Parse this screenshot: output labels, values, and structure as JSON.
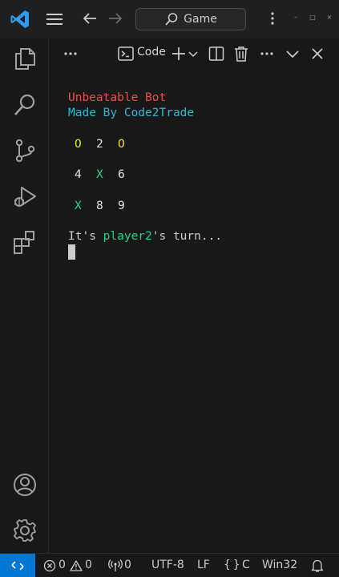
{
  "titlebar": {
    "search_label": "Game"
  },
  "panel": {
    "code_label": "Code"
  },
  "terminal": {
    "title_line": "Unbeatable Bot",
    "subtitle_line": "Made By Code2Trade",
    "board": [
      [
        "O",
        "2",
        "O"
      ],
      [
        "4",
        "X",
        "6"
      ],
      [
        "X",
        "8",
        "9"
      ]
    ],
    "turn_prefix": "It's ",
    "turn_player": "player2",
    "turn_suffix": "'s turn..."
  },
  "statusbar": {
    "errors": "0",
    "warnings": "0",
    "ports": "0",
    "encoding": "UTF-8",
    "line_ending": "LF",
    "language": "C",
    "platform": "Win32"
  },
  "colors": {
    "accent": "#0078d4",
    "title_red": "#f14c4c",
    "subtitle_blue": "#29b8db",
    "o_yellow": "#e5e510",
    "x_green": "#23d18b"
  }
}
